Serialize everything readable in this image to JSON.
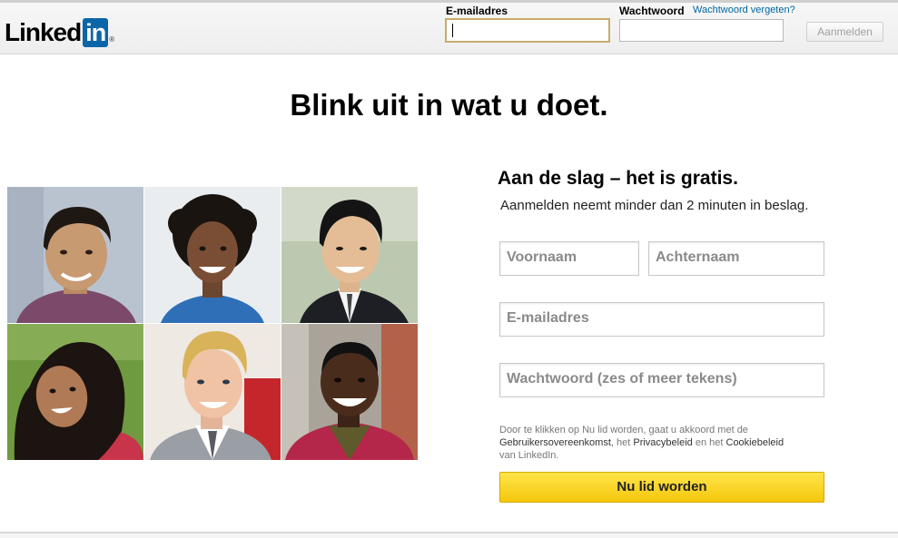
{
  "brand": {
    "word": "Linked",
    "box": "in",
    "reg": "®"
  },
  "header": {
    "email_label": "E-mailadres",
    "email_value": "",
    "password_label": "Wachtwoord",
    "forgot_link": "Wachtwoord vergeten?",
    "password_value": "",
    "signin_button": "Aanmelden"
  },
  "main": {
    "headline": "Blink uit in wat u doet."
  },
  "photos": [
    {
      "name": "portrait-man-smiling",
      "bg": "#b9c3d0"
    },
    {
      "name": "portrait-woman-curly-hair",
      "bg": "#e9edf0"
    },
    {
      "name": "portrait-man-suit",
      "bg": "#bcc9b0"
    },
    {
      "name": "portrait-woman-long-hair",
      "bg": "#6f9a3f"
    },
    {
      "name": "portrait-man-blond",
      "bg": "#efe9e4"
    },
    {
      "name": "portrait-man-brick-wall",
      "bg": "#a9a39a"
    }
  ],
  "signup": {
    "title": "Aan de slag – het is gratis.",
    "subtitle": "Aanmelden neemt minder dan 2 minuten in beslag.",
    "first_name_placeholder": "Voornaam",
    "last_name_placeholder": "Achternaam",
    "email_placeholder": "E-mailadres",
    "password_placeholder": "Wachtwoord (zes of meer tekens)",
    "terms": {
      "part1": "Door te klikken op Nu lid worden, gaat u akkoord met de",
      "user_agreement": "Gebruikersovereenkomst",
      "part2": ", het",
      "privacy_policy": "Privacybeleid",
      "part3": "en het",
      "cookie_policy": "Cookiebeleid",
      "part4": "van LinkedIn."
    },
    "join_button": "Nu lid worden"
  },
  "colors": {
    "brand_blue": "#0a66a8",
    "link_blue": "#0066a1",
    "join_yellow": "#f8d21f",
    "focus_border": "#c6ad6b"
  }
}
